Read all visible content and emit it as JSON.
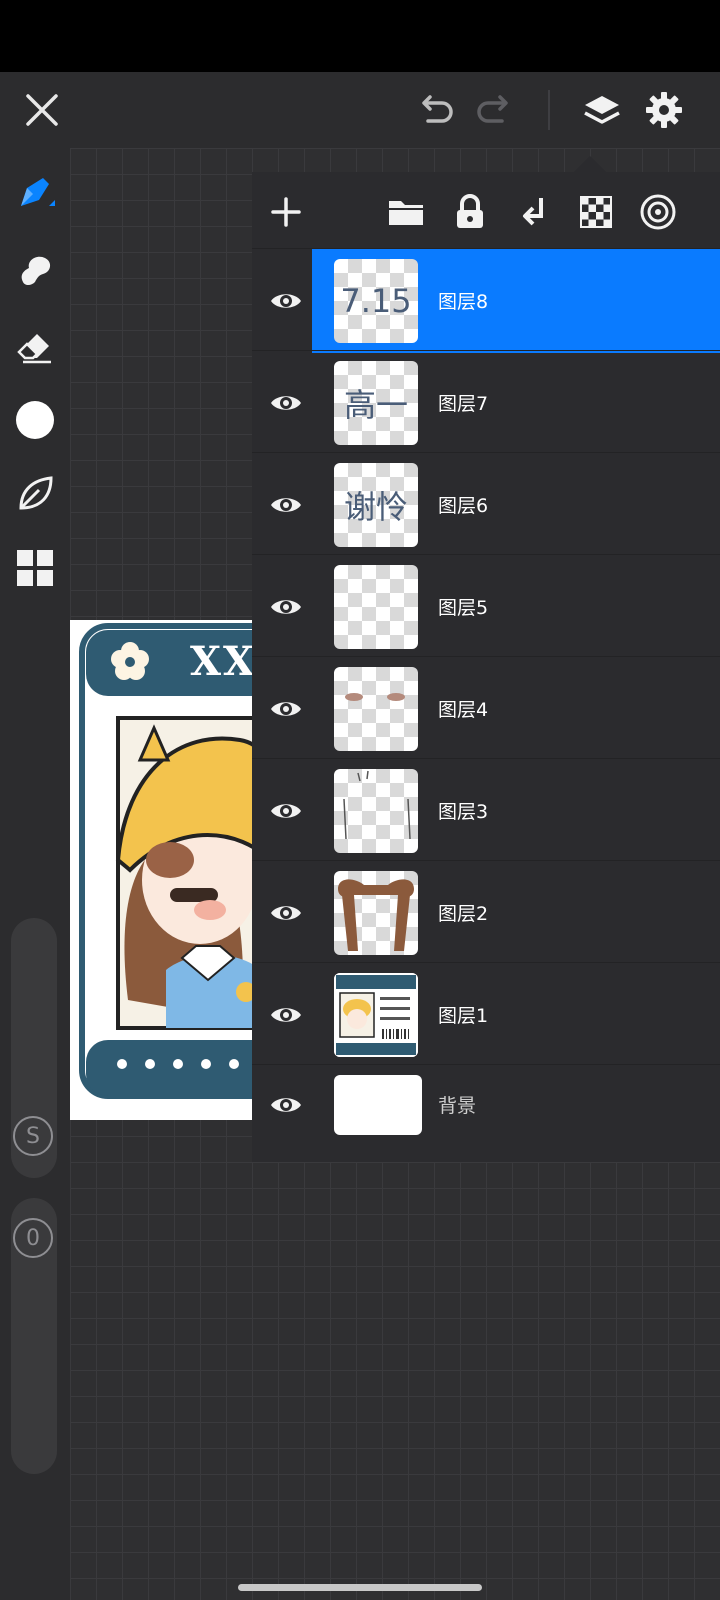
{
  "top_bar": {
    "close_icon": "close-icon",
    "undo_icon": "undo-icon",
    "redo_icon": "redo-icon",
    "layers_icon": "layers-icon",
    "settings_icon": "gear-icon"
  },
  "sidebar": {
    "tools": [
      "brush",
      "smudge",
      "eraser",
      "color",
      "leaf",
      "grid"
    ],
    "size_slider_label": "S",
    "opacity_slider_label": "0"
  },
  "layers_panel": {
    "toolbar_icons": [
      "add-icon",
      "folder-icon",
      "lock-icon",
      "merge-down-icon",
      "checker-icon",
      "target-icon"
    ],
    "layers": [
      {
        "name": "图层8",
        "thumb_text": "7.15",
        "selected": true
      },
      {
        "name": "图层7",
        "thumb_text": "高一",
        "selected": false
      },
      {
        "name": "图层6",
        "thumb_text": "谢怜",
        "selected": false
      },
      {
        "name": "图层5",
        "thumb_text": "",
        "selected": false
      },
      {
        "name": "图层4",
        "thumb_text": "",
        "selected": false
      },
      {
        "name": "图层3",
        "thumb_text": "",
        "selected": false
      },
      {
        "name": "图层2",
        "thumb_text": "",
        "selected": false
      },
      {
        "name": "图层1",
        "thumb_text": "",
        "selected": false
      },
      {
        "name": "背景",
        "thumb_text": "",
        "selected": false
      }
    ]
  },
  "artwork": {
    "header_text": "XX"
  },
  "colors": {
    "accent": "#0a7bff",
    "panel_bg": "#2b2b2e",
    "card_teal": "#2f5b72"
  }
}
